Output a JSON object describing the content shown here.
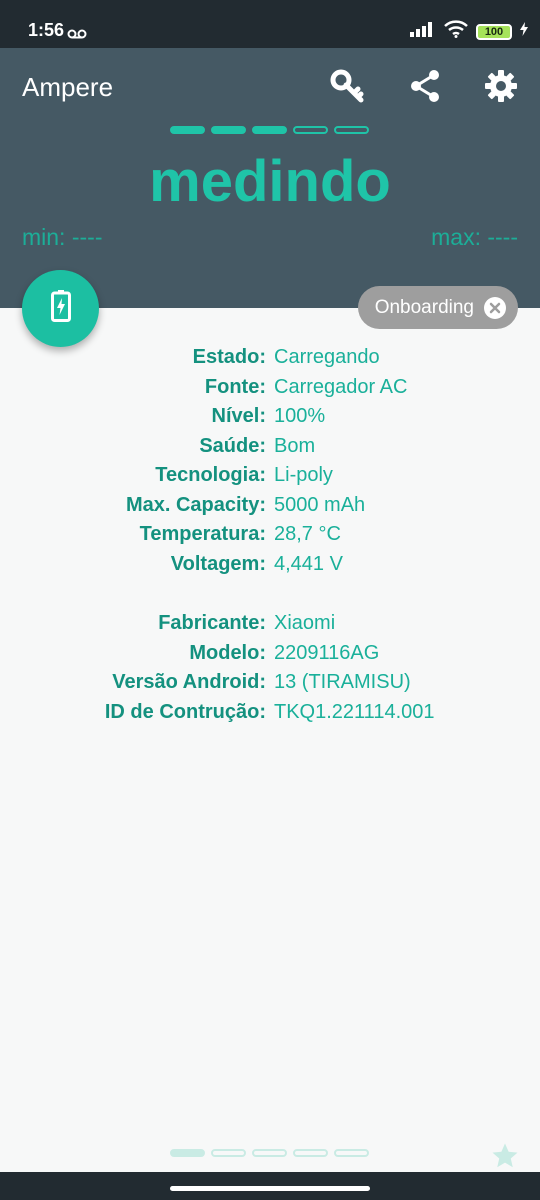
{
  "status_bar": {
    "time": "1:56",
    "battery": "100"
  },
  "header": {
    "app_title": "Ampere",
    "measure_text": "medindo",
    "min_text": "min: ----",
    "max_text": "max: ----",
    "progress": {
      "filled": 3,
      "total": 5
    }
  },
  "onboarding": {
    "label": "Onboarding"
  },
  "battery_info": [
    {
      "label": "Estado:",
      "value": "Carregando"
    },
    {
      "label": "Fonte:",
      "value": "Carregador AC"
    },
    {
      "label": "Nível:",
      "value": "100%"
    },
    {
      "label": "Saúde:",
      "value": "Bom"
    },
    {
      "label": "Tecnologia:",
      "value": "Li-poly"
    },
    {
      "label": "Max. Capacity:",
      "value": "5000 mAh"
    },
    {
      "label": "Temperatura:",
      "value": "28,7 °C"
    },
    {
      "label": "Voltagem:",
      "value": "4,441 V"
    }
  ],
  "device_info": [
    {
      "label": "Fabricante:",
      "value": "Xiaomi"
    },
    {
      "label": "Modelo:",
      "value": "2209116AG"
    },
    {
      "label": "Versão Android:",
      "value": "13 (TIRAMISU)"
    },
    {
      "label": "ID de Contrução:",
      "value": "TKQ1.221114.001"
    }
  ],
  "icons": {
    "voicemail": "voicemail-icon",
    "signal": "signal-icon",
    "wifi": "wifi-icon",
    "key": "key-icon",
    "share": "share-icon",
    "settings": "gear-icon",
    "charging": "battery-charging-icon",
    "close": "close-icon",
    "star": "star-icon"
  },
  "colors": {
    "header_bg": "#455964",
    "accent": "#1fc4a8",
    "status_bg": "#222b31"
  }
}
